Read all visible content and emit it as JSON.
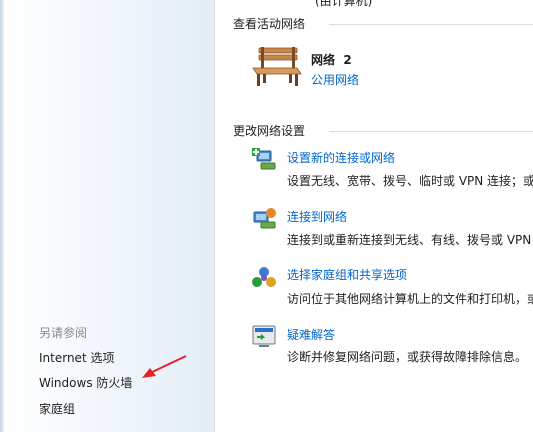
{
  "top_cut_text": "(由计算机)",
  "active_networks": {
    "title": "查看活动网络",
    "network_name": "网络",
    "network_number": "2",
    "network_type": "公用网络"
  },
  "change_settings": {
    "title": "更改网络设置",
    "tasks": [
      {
        "icon": "new-connection-icon",
        "label": "设置新的连接或网络",
        "desc": "设置无线、宽带、拨号、临时或 VPN 连接；或"
      },
      {
        "icon": "connect-network-icon",
        "label": "连接到网络",
        "desc": "连接到或重新连接到无线、有线、拨号或 VPN"
      },
      {
        "icon": "homegroup-icon",
        "label": "选择家庭组和共享选项",
        "desc": "访问位于其他网络计算机上的文件和打印机，或"
      },
      {
        "icon": "troubleshoot-icon",
        "label": "疑难解答",
        "desc": "诊断并修复网络问题，或获得故障排除信息。"
      }
    ]
  },
  "see_also": {
    "title": "另请参阅",
    "links": [
      "Internet 选项",
      "Windows 防火墙",
      "家庭组"
    ]
  },
  "colors": {
    "link": "#0066cc",
    "annotation_arrow": "#e8202a"
  }
}
